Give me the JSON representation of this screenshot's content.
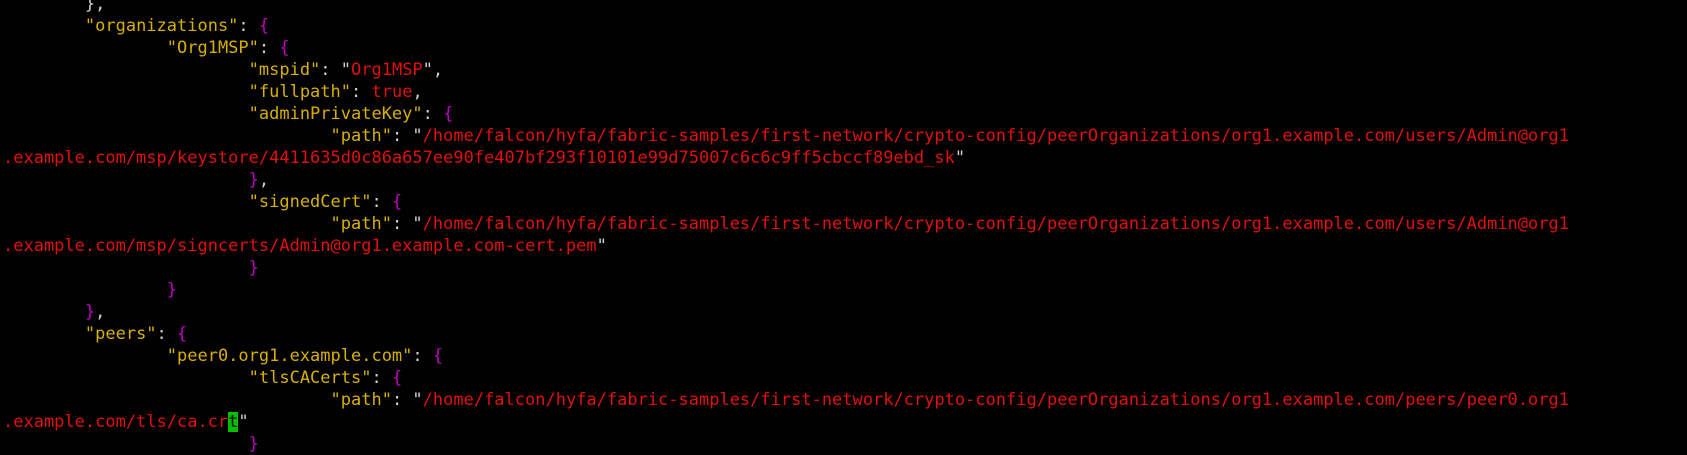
{
  "terminal": {
    "lines": [
      [
        {
          "t": "        ",
          "c": "punc"
        },
        {
          "t": "},",
          "c": "punc"
        }
      ],
      [
        {
          "t": "        ",
          "c": "punc"
        },
        {
          "t": "\"organizations\"",
          "c": "key"
        },
        {
          "t": ": ",
          "c": "punc"
        },
        {
          "t": "{",
          "c": "brace"
        }
      ],
      [
        {
          "t": "                ",
          "c": "punc"
        },
        {
          "t": "\"Org1MSP\"",
          "c": "key"
        },
        {
          "t": ": ",
          "c": "punc"
        },
        {
          "t": "{",
          "c": "brace"
        }
      ],
      [
        {
          "t": "                        ",
          "c": "punc"
        },
        {
          "t": "\"mspid\"",
          "c": "key"
        },
        {
          "t": ": \"",
          "c": "punc"
        },
        {
          "t": "Org1MSP",
          "c": "str"
        },
        {
          "t": "\",",
          "c": "punc"
        }
      ],
      [
        {
          "t": "                        ",
          "c": "punc"
        },
        {
          "t": "\"fullpath\"",
          "c": "key"
        },
        {
          "t": ": ",
          "c": "punc"
        },
        {
          "t": "true",
          "c": "bool"
        },
        {
          "t": ",",
          "c": "punc"
        }
      ],
      [
        {
          "t": "                        ",
          "c": "punc"
        },
        {
          "t": "\"adminPrivateKey\"",
          "c": "key"
        },
        {
          "t": ": ",
          "c": "punc"
        },
        {
          "t": "{",
          "c": "brace"
        }
      ],
      [
        {
          "t": "                                ",
          "c": "punc"
        },
        {
          "t": "\"path\"",
          "c": "key"
        },
        {
          "t": ": \"",
          "c": "punc"
        },
        {
          "t": "/home/falcon/hyfa/fabric-samples/first-network/crypto-config/peerOrganizations/org1.example.com/users/Admin@org1",
          "c": "str"
        }
      ],
      [
        {
          "t": ".example.com/msp/keystore/4411635d0c86a657ee90fe407bf293f10101e99d75007c6c6c9ff5cbccf89ebd_sk",
          "c": "str"
        },
        {
          "t": "\"",
          "c": "punc"
        }
      ],
      [
        {
          "t": "                        ",
          "c": "punc"
        },
        {
          "t": "}",
          "c": "brace"
        },
        {
          "t": ",",
          "c": "punc"
        }
      ],
      [
        {
          "t": "                        ",
          "c": "punc"
        },
        {
          "t": "\"signedCert\"",
          "c": "key"
        },
        {
          "t": ": ",
          "c": "punc"
        },
        {
          "t": "{",
          "c": "brace"
        }
      ],
      [
        {
          "t": "                                ",
          "c": "punc"
        },
        {
          "t": "\"path\"",
          "c": "key"
        },
        {
          "t": ": \"",
          "c": "punc"
        },
        {
          "t": "/home/falcon/hyfa/fabric-samples/first-network/crypto-config/peerOrganizations/org1.example.com/users/Admin@org1",
          "c": "str"
        }
      ],
      [
        {
          "t": ".example.com/msp/signcerts/Admin@org1.example.com-cert.pem",
          "c": "str"
        },
        {
          "t": "\"",
          "c": "punc"
        }
      ],
      [
        {
          "t": "                        ",
          "c": "punc"
        },
        {
          "t": "}",
          "c": "brace"
        }
      ],
      [
        {
          "t": "                ",
          "c": "punc"
        },
        {
          "t": "}",
          "c": "brace"
        }
      ],
      [
        {
          "t": "        ",
          "c": "punc"
        },
        {
          "t": "}",
          "c": "brace"
        },
        {
          "t": ",",
          "c": "punc"
        }
      ],
      [
        {
          "t": "        ",
          "c": "punc"
        },
        {
          "t": "\"peers\"",
          "c": "key"
        },
        {
          "t": ": ",
          "c": "punc"
        },
        {
          "t": "{",
          "c": "brace"
        }
      ],
      [
        {
          "t": "                ",
          "c": "punc"
        },
        {
          "t": "\"peer0.org1.example.com\"",
          "c": "key"
        },
        {
          "t": ": ",
          "c": "punc"
        },
        {
          "t": "{",
          "c": "brace"
        }
      ],
      [
        {
          "t": "                        ",
          "c": "punc"
        },
        {
          "t": "\"tlsCACerts\"",
          "c": "key"
        },
        {
          "t": ": ",
          "c": "punc"
        },
        {
          "t": "{",
          "c": "brace"
        }
      ],
      [
        {
          "t": "                                ",
          "c": "punc"
        },
        {
          "t": "\"path\"",
          "c": "key"
        },
        {
          "t": ": \"",
          "c": "punc"
        },
        {
          "t": "/home/falcon/hyfa/fabric-samples/first-network/crypto-config/peerOrganizations/org1.example.com/peers/peer0.org1",
          "c": "str"
        }
      ],
      [
        {
          "t": ".example.com/tls/ca.cr",
          "c": "str"
        },
        {
          "t": "t",
          "c": "cursor"
        },
        {
          "t": "\"",
          "c": "punc"
        }
      ],
      [
        {
          "t": "                        ",
          "c": "punc"
        },
        {
          "t": "}",
          "c": "brace"
        }
      ]
    ]
  }
}
